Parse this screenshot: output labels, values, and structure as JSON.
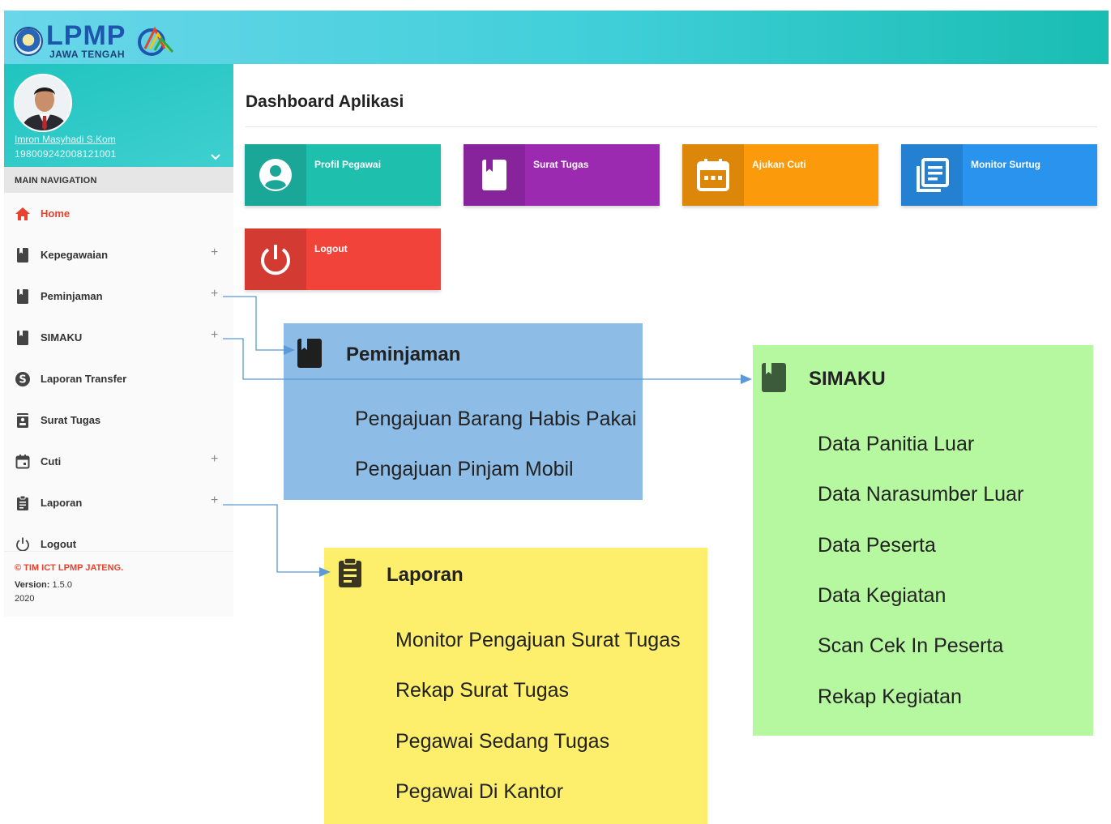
{
  "header": {
    "logo_text": "LPMP",
    "logo_subtitle": "JAWA TENGAH"
  },
  "user": {
    "name": "Imron Masyhadi S.Kom",
    "nip": "198009242008121001"
  },
  "sidebar": {
    "section_title": "MAIN NAVIGATION",
    "items": [
      {
        "label": "Home",
        "icon": "home-icon",
        "expandable": false,
        "active": true
      },
      {
        "label": "Kepegawaian",
        "icon": "book-icon",
        "expandable": true
      },
      {
        "label": "Peminjaman",
        "icon": "book-icon",
        "expandable": true
      },
      {
        "label": "SIMAKU",
        "icon": "book-icon",
        "expandable": true
      },
      {
        "label": "Laporan Transfer",
        "icon": "dollar-icon",
        "expandable": false
      },
      {
        "label": "Surat Tugas",
        "icon": "contact-card-icon",
        "expandable": false
      },
      {
        "label": "Cuti",
        "icon": "calendar-icon",
        "expandable": true
      },
      {
        "label": "Laporan",
        "icon": "clipboard-icon",
        "expandable": true
      },
      {
        "label": "Logout",
        "icon": "power-icon",
        "expandable": false
      }
    ],
    "expand_symbol": "+",
    "footer": {
      "copyright": "© TIM ICT LPMP JATENG.",
      "version_label": "Version:",
      "version_value": "1.5.0",
      "year": "2020"
    }
  },
  "content": {
    "title": "Dashboard Aplikasi",
    "tiles": [
      {
        "label": "Profil Pegawai",
        "icon": "user-circle-icon",
        "color": "#1fbfae"
      },
      {
        "label": "Surat Tugas",
        "icon": "bookmark-icon",
        "color": "#9b2ab1"
      },
      {
        "label": "Ajukan Cuti",
        "icon": "calendar-icon",
        "color": "#fb9a0b"
      },
      {
        "label": "Monitor Surtug",
        "icon": "documents-icon",
        "color": "#2a93ee"
      },
      {
        "label": "Logout",
        "icon": "power-icon",
        "color": "#f1433a"
      }
    ]
  },
  "callouts": {
    "peminjaman": {
      "title": "Peminjaman",
      "color": "#8dbde6",
      "items": [
        "Pengajuan Barang Habis Pakai",
        "Pengajuan Pinjam Mobil"
      ]
    },
    "simaku": {
      "title": "SIMAKU",
      "color": "#b6f89f",
      "items": [
        "Data Panitia Luar",
        "Data Narasumber Luar",
        "Data Peserta",
        "Data Kegiatan",
        "Scan Cek In Peserta",
        "Rekap Kegiatan"
      ]
    },
    "laporan": {
      "title": "Laporan",
      "color": "#fdee6b",
      "items": [
        "Monitor Pengajuan Surat Tugas",
        "Rekap Surat Tugas",
        "Pegawai Sedang Tugas",
        "Pegawai Di Kantor"
      ]
    }
  }
}
